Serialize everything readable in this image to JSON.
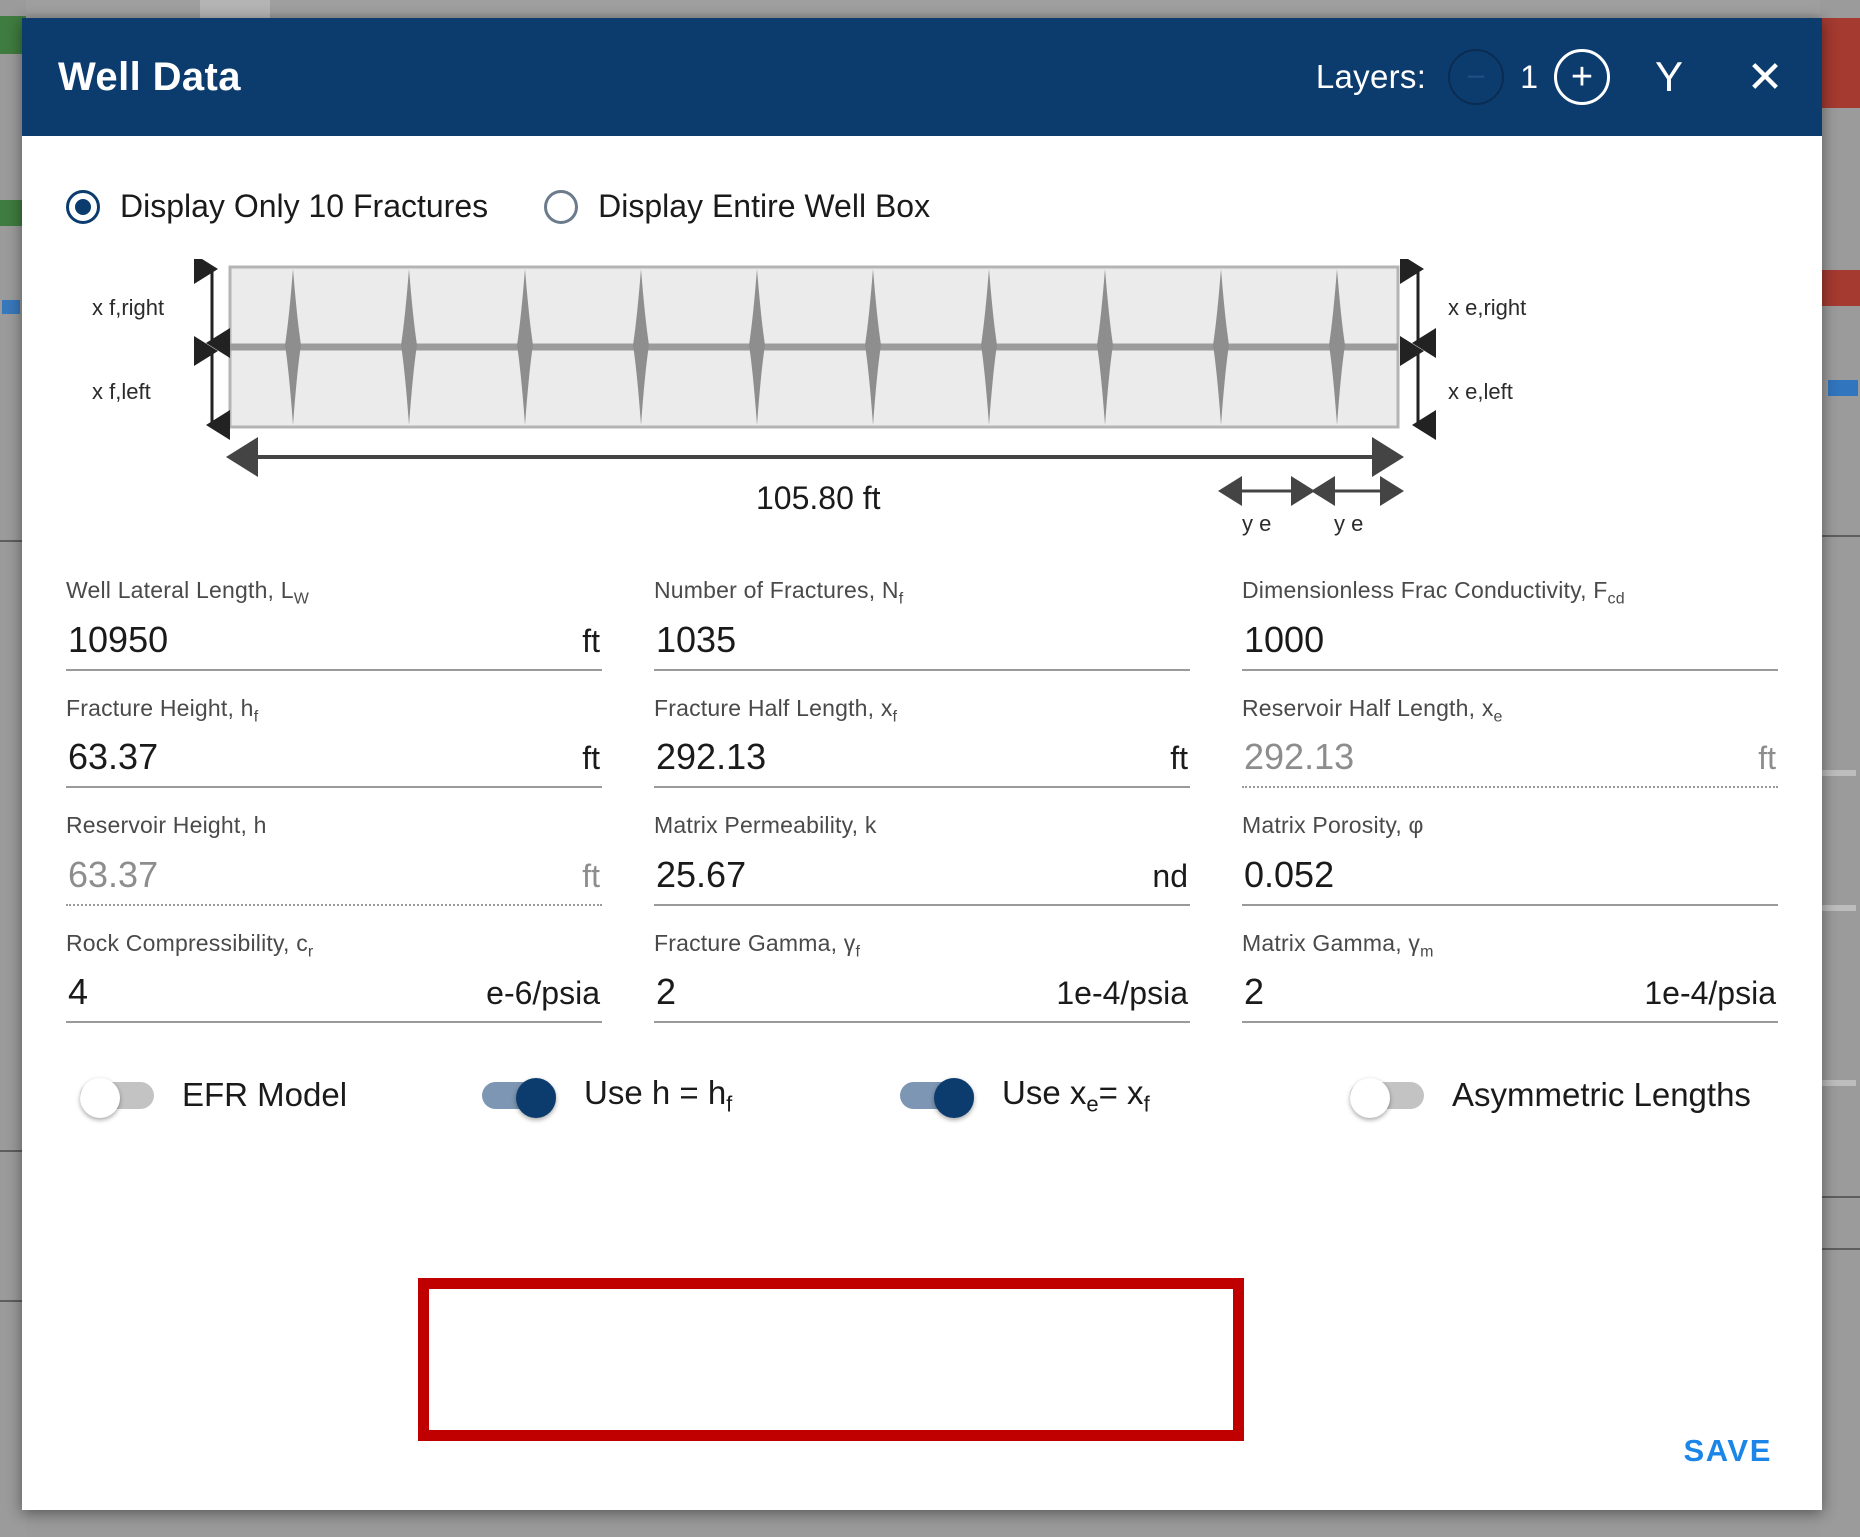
{
  "window": {
    "title": "Well Data",
    "layers_label": "Layers:",
    "layers_count": "1",
    "decrement_label": "−",
    "increment_label": "+",
    "gamma_icon_glyph": "Υ",
    "close_icon_glyph": "✕"
  },
  "display_options": {
    "option_1": {
      "label": "Display Only 10 Fractures",
      "selected": true
    },
    "option_2": {
      "label": "Display Entire Well Box",
      "selected": false
    }
  },
  "diagram": {
    "label_xf_right": "x f,right",
    "label_xf_left": "x f,left",
    "label_xe_right": "x e,right",
    "label_xe_left": "x e,left",
    "label_ye_1": "y e",
    "label_ye_2": "y e",
    "total_length": "105.80 ft",
    "fracture_count": 10
  },
  "fields": {
    "rows": [
      [
        {
          "label": "Well Lateral Length, L",
          "sub": "W",
          "value": "10950",
          "unit": "ft",
          "disabled": false
        },
        {
          "label": "Number of Fractures, N",
          "sub": "f",
          "value": "1035",
          "unit": "",
          "disabled": false
        },
        {
          "label": "Dimensionless Frac Conductivity, F",
          "sub": "cd",
          "value": "1000",
          "unit": "",
          "disabled": false
        }
      ],
      [
        {
          "label": "Fracture Height, h",
          "sub": "f",
          "value": "63.37",
          "unit": "ft",
          "disabled": false
        },
        {
          "label": "Fracture Half Length, x",
          "sub": "f",
          "value": "292.13",
          "unit": "ft",
          "disabled": false
        },
        {
          "label": "Reservoir Half Length, x",
          "sub": "e",
          "value": "292.13",
          "unit": "ft",
          "disabled": true
        }
      ],
      [
        {
          "label": "Reservoir Height, h",
          "sub": "",
          "value": "63.37",
          "unit": "ft",
          "disabled": true
        },
        {
          "label": "Matrix Permeability, k",
          "sub": "",
          "value": "25.67",
          "unit": "nd",
          "disabled": false
        },
        {
          "label": "Matrix Porosity, φ",
          "sub": "",
          "value": "0.052",
          "unit": "",
          "disabled": false
        }
      ],
      [
        {
          "label": "Rock Compressibility, c",
          "sub": "r",
          "value": "4",
          "unit": "e-6/psia",
          "disabled": false
        },
        {
          "label": "Fracture Gamma, γ",
          "sub": "f",
          "value": "2",
          "unit": "1e-4/psia",
          "disabled": false
        },
        {
          "label": "Matrix Gamma, γ",
          "sub": "m",
          "value": "2",
          "unit": "1e-4/psia",
          "disabled": false
        }
      ]
    ]
  },
  "toggles": {
    "efr_model": {
      "label": "EFR Model",
      "on": false
    },
    "use_h_hf": {
      "label": "Use h = h",
      "sub": "f",
      "on": true
    },
    "use_xe_xf": {
      "label_pre": "Use x",
      "sub1": "e",
      "label_mid": "= x",
      "sub2": "f",
      "on": true
    },
    "asymmetric": {
      "label": "Asymmetric Lengths",
      "on": false
    }
  },
  "footer": {
    "save_label": "SAVE"
  },
  "colors": {
    "header_blue": "#0c3c6e",
    "accent_blue": "#1c86e8",
    "highlight_red": "#c00000",
    "toggle_on_track": "#7d96b3",
    "toggle_off_track": "#c3c3c3"
  }
}
